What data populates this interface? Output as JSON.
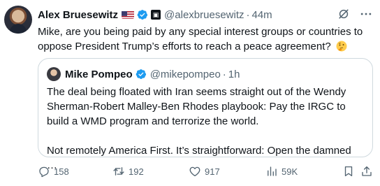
{
  "tweet": {
    "author_name": "Alex Bruesewitz",
    "handle": "@alexbruesewitz",
    "separator": "·",
    "time": "44m",
    "text": "Mike, are you being paid by any special interest groups or countries to oppose President Trump’s efforts to reach a peace agreement?",
    "emoji": "thinking-face-emoji"
  },
  "quote": {
    "author_name": "Mike Pompeo",
    "handle": "@mikepompeo",
    "separator": "·",
    "time": "1h",
    "paragraph1": "The deal being floated with Iran seems straight out of the Wendy Sherman-Robert Malley-Ben Rhodes playbook: Pay the IRGC to build a WMD program and terrorize the world.",
    "paragraph2": "Not remotely America First. It’s straightforward: Open the damned …"
  },
  "actions": {
    "replies": "158",
    "reposts": "192",
    "likes": "917",
    "views": "59K"
  },
  "colors": {
    "verified": "#1d9bf0",
    "secondary_text": "#536471",
    "border": "#cfd9de"
  }
}
